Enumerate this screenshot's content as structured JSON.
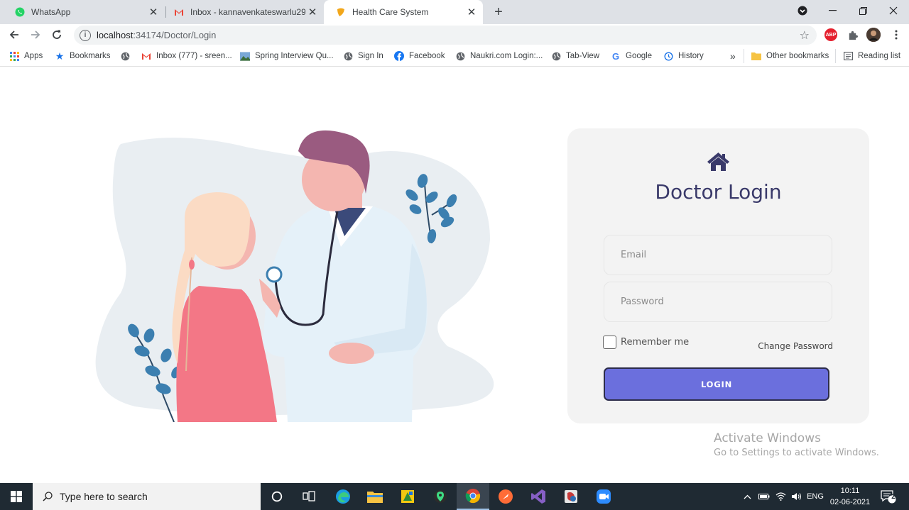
{
  "browser": {
    "tabs": [
      {
        "title": "WhatsApp",
        "icon": "whatsapp-icon",
        "active": false
      },
      {
        "title": "Inbox - kannavenkateswarlu29@",
        "icon": "gmail-icon",
        "active": false
      },
      {
        "title": "Health Care System",
        "icon": "leaf-icon",
        "active": true
      }
    ],
    "new_tab_symbol": "+",
    "address": {
      "host": "localhost",
      "path": ":34174/Doctor/Login"
    },
    "extensions": [
      {
        "name": "abp-icon",
        "label": "ABP",
        "color": "#e5202e"
      },
      {
        "name": "puzzle-icon",
        "label": "",
        "color": "#5f6368"
      },
      {
        "name": "profile-avatar",
        "label": "",
        "color": "#3b2a23"
      }
    ]
  },
  "bookmarks": {
    "items": [
      {
        "label": "Apps",
        "icon": "apps-grid-icon"
      },
      {
        "label": "Bookmarks",
        "icon": "star-icon"
      },
      {
        "label": "",
        "icon": "globe-icon"
      },
      {
        "label": "Inbox (777) - sreen...",
        "icon": "gmail-icon"
      },
      {
        "label": "Spring Interview Qu...",
        "icon": "image-icon"
      },
      {
        "label": "Sign In",
        "icon": "globe-icon"
      },
      {
        "label": "Facebook",
        "icon": "facebook-icon"
      },
      {
        "label": "Naukri.com Login:...",
        "icon": "globe-icon"
      },
      {
        "label": "Tab-View",
        "icon": "globe-icon"
      },
      {
        "label": "Google",
        "icon": "google-icon"
      },
      {
        "label": "History",
        "icon": "history-icon"
      }
    ],
    "overflow": "»",
    "other": "Other bookmarks",
    "reading_list": "Reading list"
  },
  "login": {
    "title": "Doctor Login",
    "email_placeholder": "Email",
    "password_placeholder": "Password",
    "remember_label": "Remember me",
    "change_password": "Change Password",
    "button_label": "LOGIN",
    "accent_color": "#6b6fdd",
    "title_color": "#3a3a6a"
  },
  "watermark": {
    "line1": "Activate Windows",
    "line2": "Go to Settings to activate Windows."
  },
  "taskbar": {
    "search_placeholder": "Type here to search",
    "language": "ENG",
    "time": "10:11",
    "date": "02-06-2021",
    "notifications": "2"
  }
}
